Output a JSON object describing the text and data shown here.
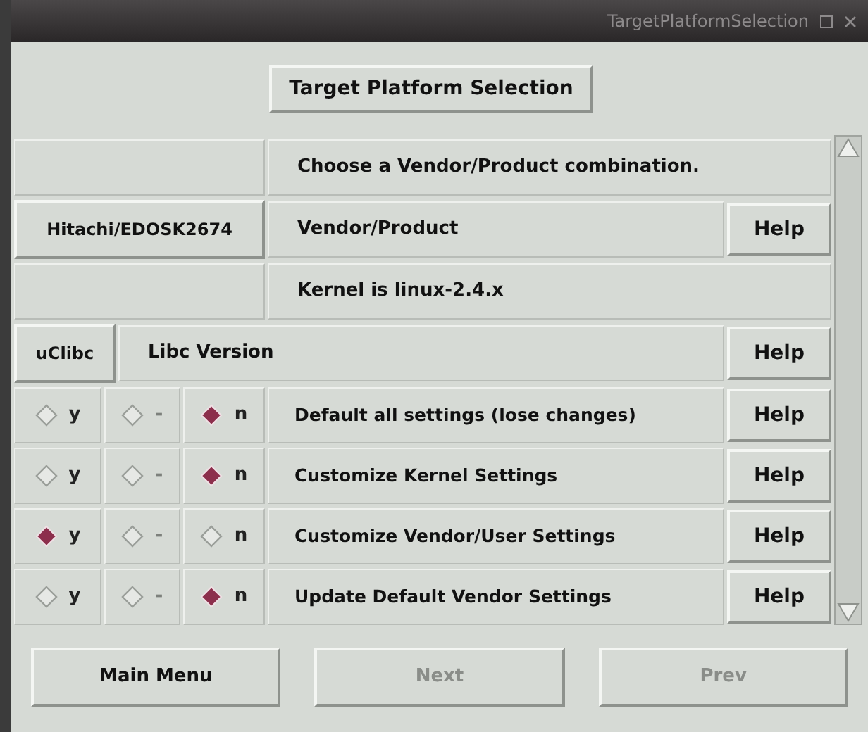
{
  "window": {
    "title": "TargetPlatformSelection"
  },
  "header_button": "Target Platform Selection",
  "rows": [
    {
      "kind": "info",
      "text": "Choose a Vendor/Product combination."
    },
    {
      "kind": "choice",
      "value": "Hitachi/EDOSK2674",
      "label": "Vendor/Product",
      "help": "Help"
    },
    {
      "kind": "info",
      "text": "Kernel is linux-2.4.x"
    },
    {
      "kind": "libc",
      "value": "uClibc",
      "label": "Libc Version",
      "help": "Help"
    },
    {
      "kind": "tristate",
      "options": [
        {
          "label": "y",
          "selected": false,
          "disabled": false
        },
        {
          "label": "-",
          "selected": false,
          "disabled": true
        },
        {
          "label": "n",
          "selected": true,
          "disabled": false
        }
      ],
      "label": "Default all settings (lose changes)",
      "help": "Help"
    },
    {
      "kind": "tristate",
      "options": [
        {
          "label": "y",
          "selected": false,
          "disabled": false
        },
        {
          "label": "-",
          "selected": false,
          "disabled": true
        },
        {
          "label": "n",
          "selected": true,
          "disabled": false
        }
      ],
      "label": "Customize Kernel Settings",
      "help": "Help"
    },
    {
      "kind": "tristate",
      "options": [
        {
          "label": "y",
          "selected": true,
          "disabled": false
        },
        {
          "label": "-",
          "selected": false,
          "disabled": true
        },
        {
          "label": "n",
          "selected": false,
          "disabled": false
        }
      ],
      "label": "Customize Vendor/User Settings",
      "help": "Help"
    },
    {
      "kind": "tristate",
      "options": [
        {
          "label": "y",
          "selected": false,
          "disabled": false
        },
        {
          "label": "-",
          "selected": false,
          "disabled": true
        },
        {
          "label": "n",
          "selected": true,
          "disabled": false
        }
      ],
      "label": "Update Default Vendor Settings",
      "help": "Help"
    }
  ],
  "footer_buttons": [
    {
      "label": "Main Menu",
      "disabled": false
    },
    {
      "label": "Next",
      "disabled": true
    },
    {
      "label": "Prev",
      "disabled": true
    }
  ]
}
